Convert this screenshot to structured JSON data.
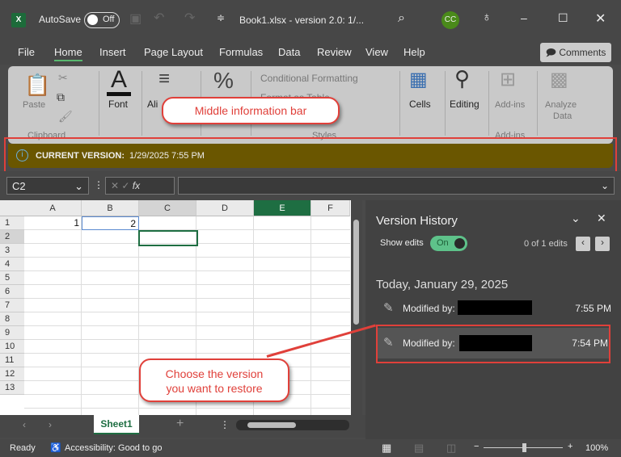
{
  "titlebar": {
    "app_icon": "X",
    "autosave_label": "AutoSave",
    "autosave_state": "Off",
    "title": "Book1.xlsx  -  version 2.0: 1/...",
    "avatar": "CC"
  },
  "menu": {
    "items": [
      "File",
      "Home",
      "Insert",
      "Page Layout",
      "Formulas",
      "Data",
      "Review",
      "View",
      "Help"
    ],
    "comments": "Comments"
  },
  "ribbon": {
    "paste": "Paste",
    "font": "Font",
    "alignment": "Ali",
    "conditional_formatting": "Conditional Formatting",
    "format_as_table": "Format as Table",
    "cells": "Cells",
    "editing": "Editing",
    "addins": "Add-ins",
    "analyze": "Analyze",
    "analyze2": "Data",
    "groups": {
      "clipboard": "Clipboard",
      "styles": "Styles",
      "addins": "Add-ins"
    }
  },
  "infobar": {
    "label": "CURRENT VERSION:",
    "value": "1/29/2025 7:55 PM"
  },
  "callouts": {
    "middle": "Middle information bar",
    "choose1": "Choose the version",
    "choose2": "you want to restore"
  },
  "formula": {
    "namebox": "C2",
    "fx": "fx"
  },
  "grid": {
    "columns": [
      "A",
      "B",
      "C",
      "D",
      "E",
      "F"
    ],
    "rows": [
      "1",
      "2",
      "3",
      "4",
      "5",
      "6",
      "7",
      "8",
      "9",
      "10",
      "11",
      "12",
      "13"
    ],
    "A1": "1",
    "B1": "2"
  },
  "sheets": {
    "active": "Sheet1"
  },
  "panel": {
    "title": "Version History",
    "show_edits": "Show edits",
    "toggle": "On",
    "edits_count": "0 of 1 edits",
    "date_header": "Today, January 29, 2025",
    "versions": [
      {
        "label": "Modified by:",
        "time": "7:55 PM"
      },
      {
        "label": "Modified by:",
        "time": "7:54 PM"
      }
    ]
  },
  "status": {
    "ready": "Ready",
    "accessibility": "Accessibility: Good to go",
    "zoom": "100%"
  }
}
